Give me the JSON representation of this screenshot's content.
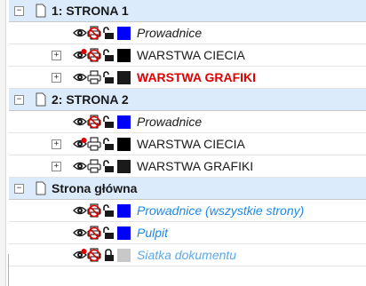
{
  "colors": {
    "selected_row": "#dcebfc",
    "master_layer_text": "#1e88e5",
    "active_layer_text": "#e00000"
  },
  "pages": [
    {
      "name": "1: STRONA 1",
      "selected": true,
      "expander": "⊟",
      "layers": [
        {
          "name": "Prowadnice",
          "style": "italic",
          "color": "#0000ff",
          "text_color": "#1a1a1a",
          "has_expander": false,
          "visible": true,
          "printable": false,
          "locked": false,
          "eye": "eye-icon",
          "print_icon": "printer-disabled-icon",
          "lock_icon": "unlock-icon"
        },
        {
          "name": "WARSTWA CIECIA",
          "style": "normal",
          "color": "#000000",
          "text_color": "#1a1a1a",
          "has_expander": true,
          "expander": "⊞",
          "visible": false,
          "printable": false,
          "locked": false,
          "eye": "eye-hidden-icon",
          "print_icon": "printer-disabled-icon",
          "lock_icon": "unlock-icon"
        },
        {
          "name": "WARSTWA GRAFIKI",
          "style": "bold",
          "color": "#1a1a1a",
          "text_color": "#e00000",
          "has_expander": true,
          "expander": "⊞",
          "visible": true,
          "printable": true,
          "locked": false,
          "eye": "eye-icon",
          "print_icon": "printer-icon",
          "lock_icon": "unlock-icon"
        }
      ]
    },
    {
      "name": "2: STRONA 2",
      "selected": true,
      "expander": "⊟",
      "layers": [
        {
          "name": "Prowadnice",
          "style": "italic",
          "color": "#0000ff",
          "text_color": "#1a1a1a",
          "has_expander": false,
          "visible": true,
          "printable": false,
          "locked": false,
          "eye": "eye-icon",
          "print_icon": "printer-disabled-icon",
          "lock_icon": "unlock-icon"
        },
        {
          "name": "WARSTWA CIECIA",
          "style": "normal",
          "color": "#000000",
          "text_color": "#1a1a1a",
          "has_expander": true,
          "expander": "⊞",
          "visible": false,
          "printable": true,
          "locked": false,
          "eye": "eye-hidden-icon",
          "print_icon": "printer-icon",
          "lock_icon": "unlock-icon"
        },
        {
          "name": "WARSTWA GRAFIKI",
          "style": "normal",
          "color": "#1a1a1a",
          "text_color": "#1a1a1a",
          "has_expander": true,
          "expander": "⊞",
          "visible": true,
          "printable": true,
          "locked": false,
          "eye": "eye-icon",
          "print_icon": "printer-icon",
          "lock_icon": "unlock-icon"
        }
      ]
    },
    {
      "name": "Strona główna",
      "selected": true,
      "expander": "⊟",
      "layers": [
        {
          "name": "Prowadnice (wszystkie strony)",
          "style": "italic",
          "color": "#0000ff",
          "text_color": "#1e88e5",
          "has_expander": false,
          "visible": true,
          "printable": false,
          "locked": false,
          "eye": "eye-icon",
          "print_icon": "printer-disabled-icon",
          "lock_icon": "unlock-icon"
        },
        {
          "name": "Pulpit",
          "style": "italic",
          "color": "#0000ff",
          "text_color": "#1e88e5",
          "has_expander": false,
          "visible": true,
          "printable": false,
          "locked": false,
          "eye": "eye-icon",
          "print_icon": "printer-disabled-icon",
          "lock_icon": "unlock-icon"
        },
        {
          "name": "Siatka dokumentu",
          "style": "italic",
          "color": "#c8c8c8",
          "text_color": "#5aa9e6",
          "has_expander": false,
          "visible": false,
          "printable": false,
          "locked": true,
          "eye": "eye-hidden-icon",
          "print_icon": "printer-disabled-icon",
          "lock_icon": "lock-icon"
        }
      ]
    }
  ]
}
